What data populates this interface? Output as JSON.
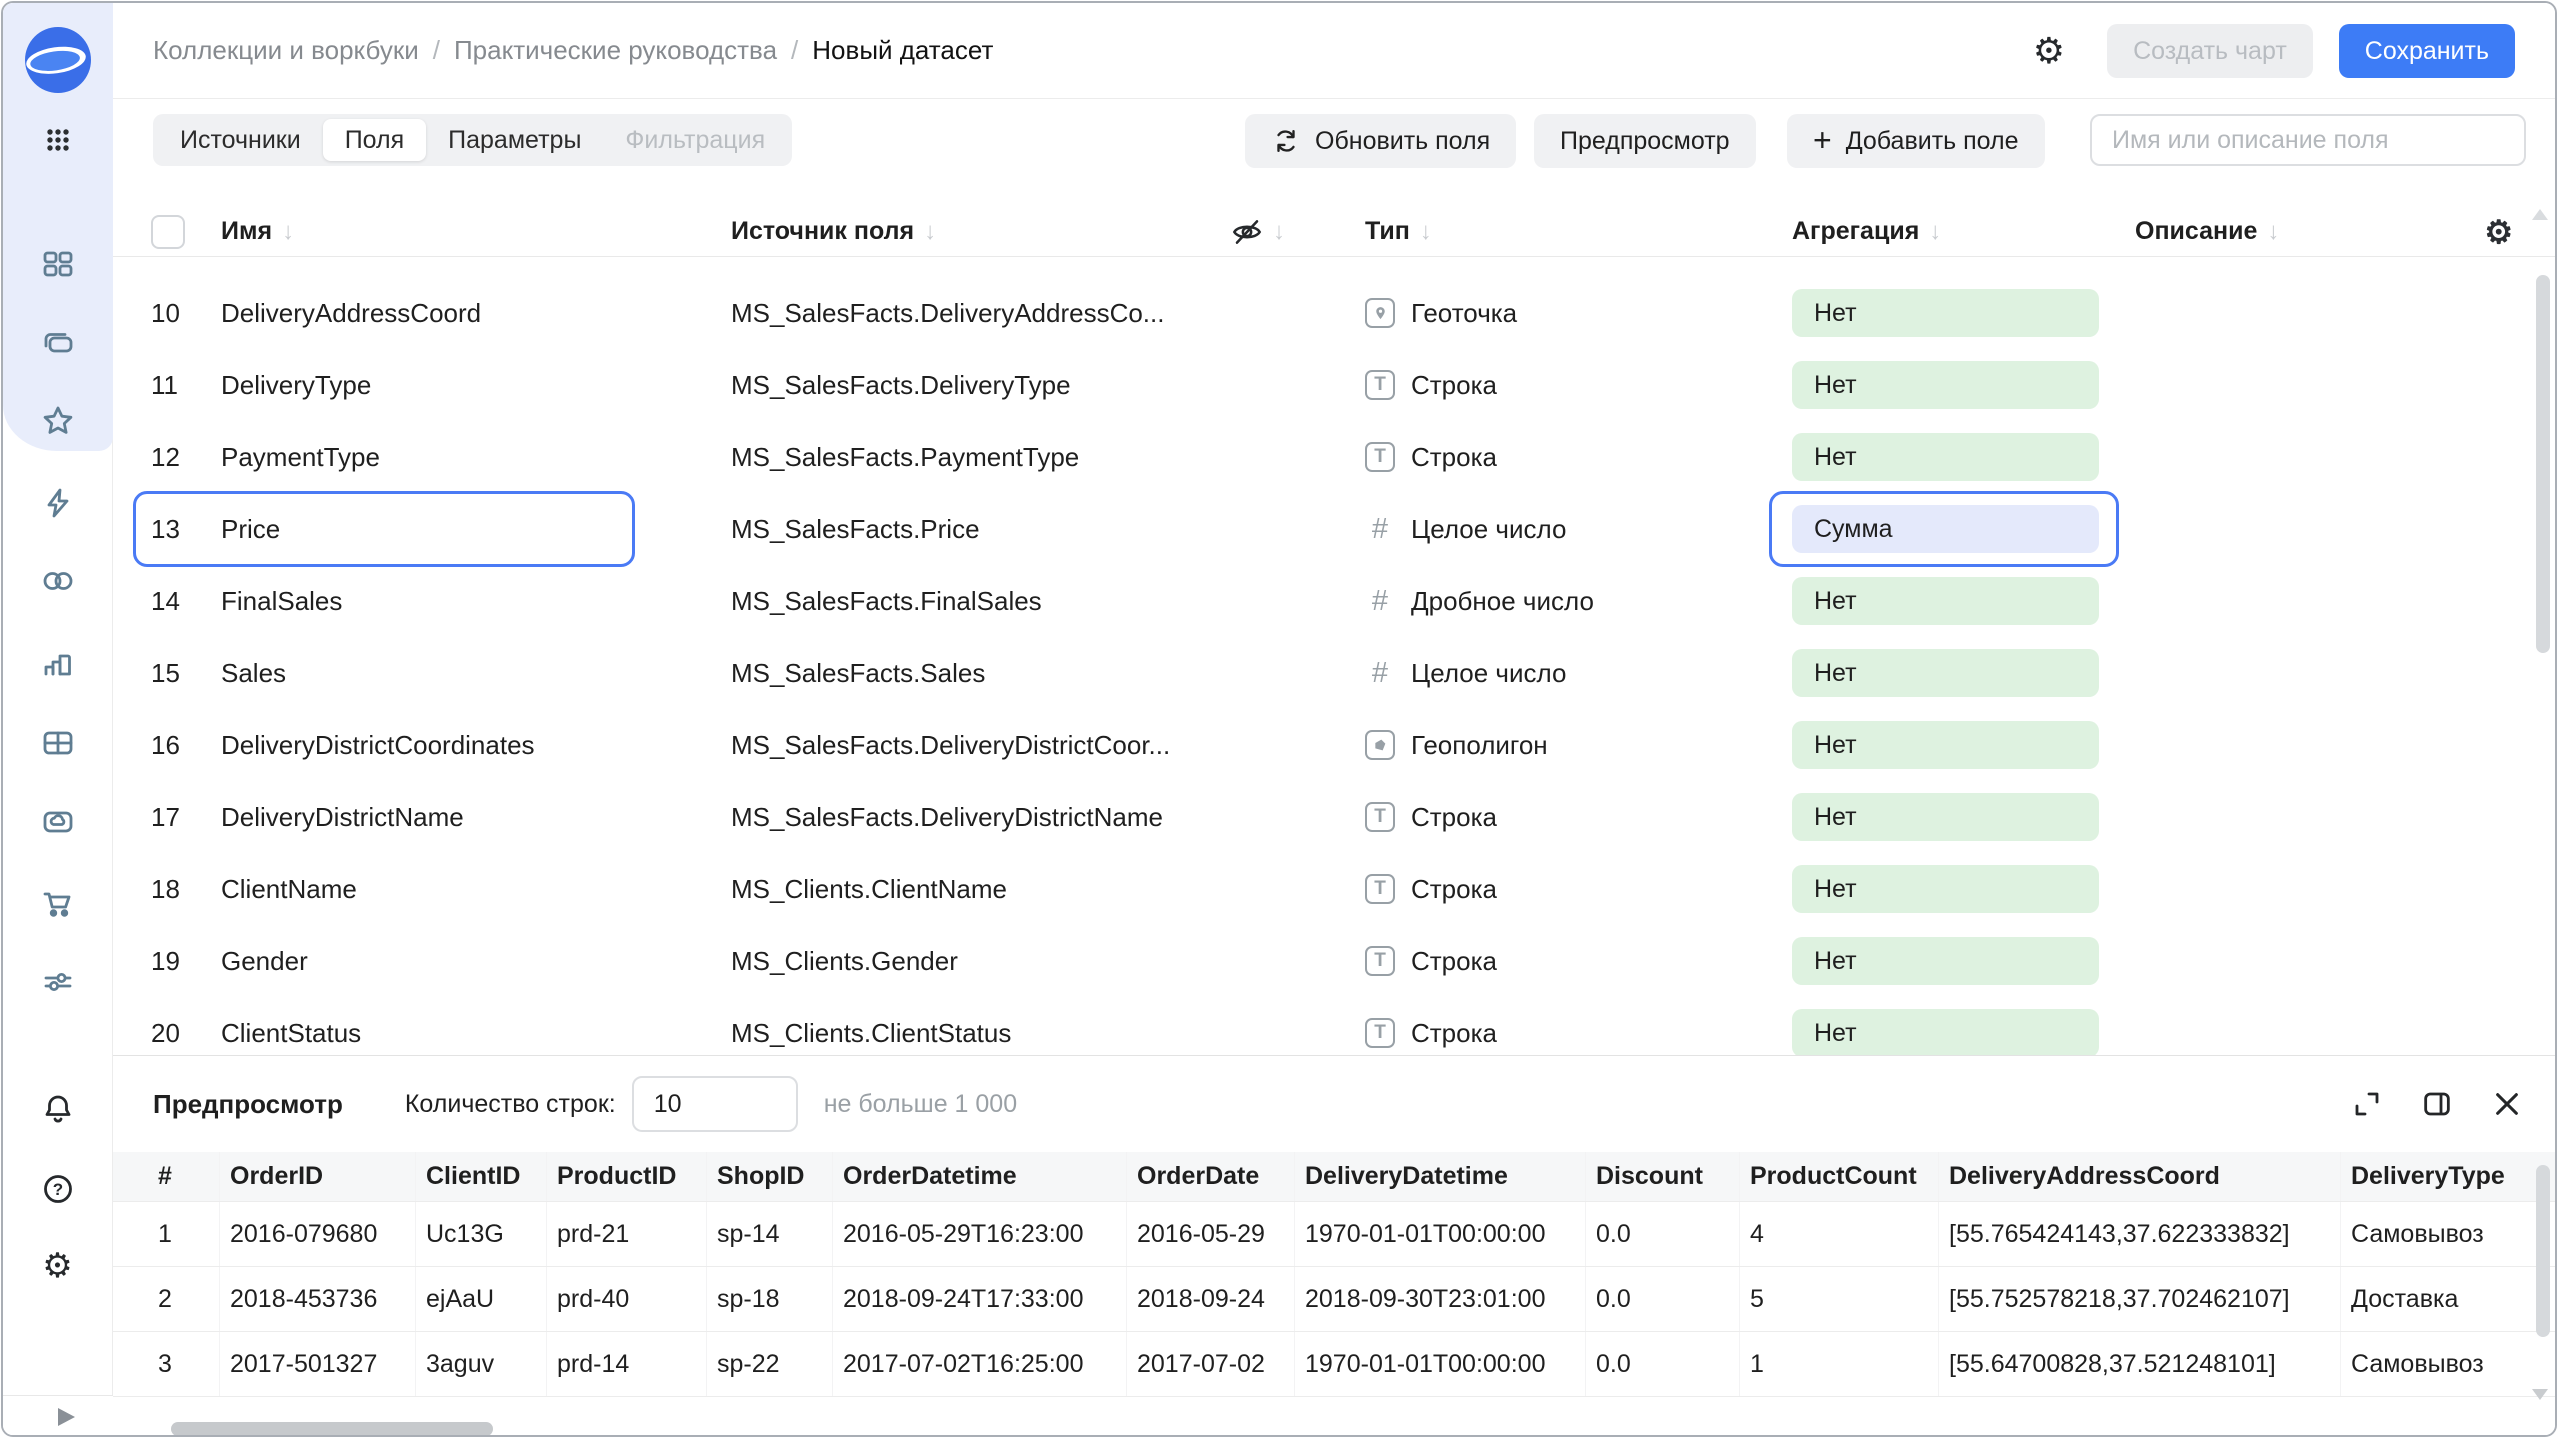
{
  "colors": {
    "accent_blue": "#3d7cf6",
    "selection_outline": "#4a7af5",
    "pill_green": "#def2e0",
    "pill_blue": "#e4e9fb",
    "sidebar_icon": "#5f7d92",
    "sidebar_blob": "#e8edfb"
  },
  "window": {
    "breadcrumbs": [
      "Коллекции и воркбуки",
      "Практические руководства",
      "Новый датасет"
    ],
    "create_chart_label": "Создать чарт",
    "save_label": "Сохранить",
    "settings_icon": "gear-icon"
  },
  "toolbar": {
    "tabs": [
      {
        "label": "Источники",
        "state": "normal"
      },
      {
        "label": "Поля",
        "state": "active"
      },
      {
        "label": "Параметры",
        "state": "normal"
      },
      {
        "label": "Фильтрация",
        "state": "disabled"
      }
    ],
    "refresh_label": "Обновить поля",
    "preview_label": "Предпросмотр",
    "add_field_label": "Добавить поле",
    "search_placeholder": "Имя или описание поля"
  },
  "fields_table": {
    "headers": {
      "name": "Имя",
      "source": "Источник поля",
      "hidden_icon": "eye-off-icon",
      "type": "Тип",
      "aggregation": "Агрегация",
      "description": "Описание",
      "settings_icon": "gear-icon"
    },
    "rows": [
      {
        "num": "10",
        "name": "DeliveryAddressCoord",
        "source": "MS_SalesFacts.DeliveryAddressCo...",
        "type_kind": "geopoint",
        "type": "Геоточка",
        "aggregation": "Нет",
        "selected": false
      },
      {
        "num": "11",
        "name": "DeliveryType",
        "source": "MS_SalesFacts.DeliveryType",
        "type_kind": "string",
        "type": "Строка",
        "aggregation": "Нет",
        "selected": false
      },
      {
        "num": "12",
        "name": "PaymentType",
        "source": "MS_SalesFacts.PaymentType",
        "type_kind": "string",
        "type": "Строка",
        "aggregation": "Нет",
        "selected": false
      },
      {
        "num": "13",
        "name": "Price",
        "source": "MS_SalesFacts.Price",
        "type_kind": "integer",
        "type": "Целое число",
        "aggregation": "Сумма",
        "selected": true
      },
      {
        "num": "14",
        "name": "FinalSales",
        "source": "MS_SalesFacts.FinalSales",
        "type_kind": "float",
        "type": "Дробное число",
        "aggregation": "Нет",
        "selected": false
      },
      {
        "num": "15",
        "name": "Sales",
        "source": "MS_SalesFacts.Sales",
        "type_kind": "integer",
        "type": "Целое число",
        "aggregation": "Нет",
        "selected": false
      },
      {
        "num": "16",
        "name": "DeliveryDistrictCoordinates",
        "source": "MS_SalesFacts.DeliveryDistrictCoor...",
        "type_kind": "geopolygon",
        "type": "Геополигон",
        "aggregation": "Нет",
        "selected": false
      },
      {
        "num": "17",
        "name": "DeliveryDistrictName",
        "source": "MS_SalesFacts.DeliveryDistrictName",
        "type_kind": "string",
        "type": "Строка",
        "aggregation": "Нет",
        "selected": false
      },
      {
        "num": "18",
        "name": "ClientName",
        "source": "MS_Clients.ClientName",
        "type_kind": "string",
        "type": "Строка",
        "aggregation": "Нет",
        "selected": false
      },
      {
        "num": "19",
        "name": "Gender",
        "source": "MS_Clients.Gender",
        "type_kind": "string",
        "type": "Строка",
        "aggregation": "Нет",
        "selected": false
      },
      {
        "num": "20",
        "name": "ClientStatus",
        "source": "MS_Clients.ClientStatus",
        "type_kind": "string",
        "type": "Строка",
        "aggregation": "Нет",
        "selected": false
      }
    ]
  },
  "preview_panel": {
    "title": "Предпросмотр",
    "row_count_label": "Количество строк:",
    "row_count_value": "10",
    "limit_hint": "не больше 1 000",
    "expand_icon": "expand-icon",
    "split_icon": "split-panel-icon",
    "close_icon": "close-icon",
    "columns": [
      "#",
      "OrderID",
      "ClientID",
      "ProductID",
      "ShopID",
      "OrderDatetime",
      "OrderDate",
      "DeliveryDatetime",
      "Discount",
      "ProductCount",
      "DeliveryAddressCoord",
      "DeliveryType"
    ],
    "rows": [
      [
        "1",
        "2016-079680",
        "Uc13G",
        "prd-21",
        "sp-14",
        "2016-05-29T16:23:00",
        "2016-05-29",
        "1970-01-01T00:00:00",
        "0.0",
        "4",
        "[55.765424143,37.622333832]",
        "Самовывоз"
      ],
      [
        "2",
        "2018-453736",
        "ejAaU",
        "prd-40",
        "sp-18",
        "2018-09-24T17:33:00",
        "2018-09-24",
        "2018-09-30T23:01:00",
        "0.0",
        "5",
        "[55.752578218,37.702462107]",
        "Доставка"
      ],
      [
        "3",
        "2017-501327",
        "3aguv",
        "prd-14",
        "sp-22",
        "2017-07-02T16:25:00",
        "2017-07-02",
        "1970-01-01T00:00:00",
        "0.0",
        "1",
        "[55.64700828,37.521248101]",
        "Самовывоз"
      ]
    ]
  },
  "sidebar": {
    "nav_icons": [
      "grid-menu-icon",
      "tiles-icon",
      "copies-icon",
      "star-icon",
      "lightning-icon",
      "rings-icon",
      "bar-chart-icon",
      "table-icon",
      "cloud-folder-icon",
      "cart-icon",
      "sliders-icon"
    ],
    "footer_icons": [
      "bell-icon",
      "help-icon",
      "gear-icon"
    ],
    "collapse_icon": "play-icon"
  }
}
